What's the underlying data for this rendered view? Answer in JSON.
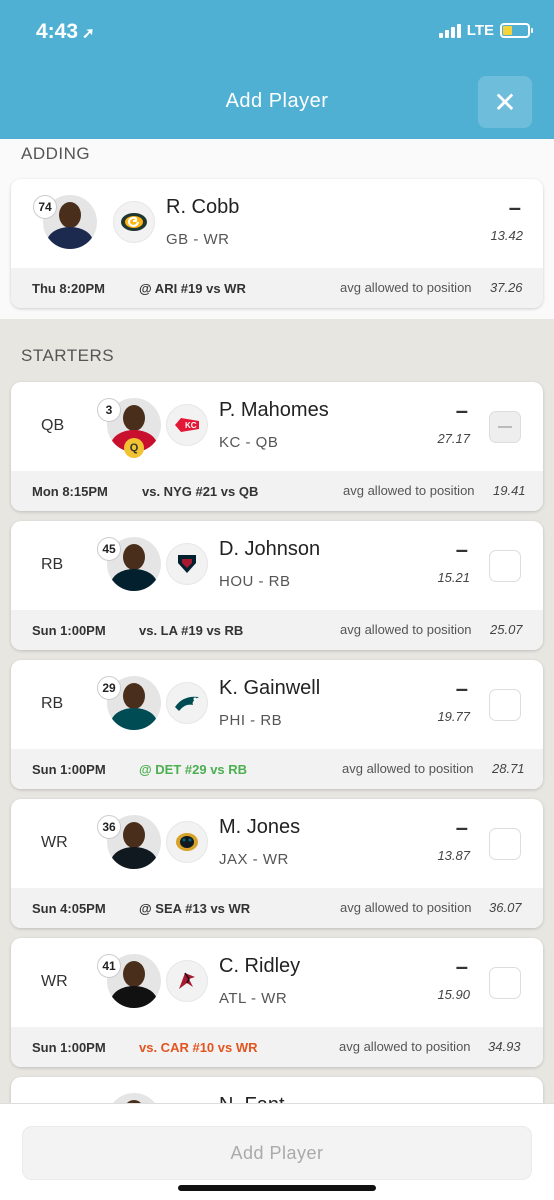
{
  "status_bar": {
    "time": "4:43",
    "network": "LTE"
  },
  "header": {
    "title": "Add Player",
    "close_icon": "close-icon"
  },
  "adding": {
    "label": "ADDING",
    "player": {
      "name": "R. Cobb",
      "team_pos": "GB - WR",
      "rank": "74",
      "score": "–",
      "projection": "13.42",
      "game_time": "Thu 8:20PM",
      "opponent": "@ ARI #19 vs WR",
      "avg_label": "avg allowed to position",
      "avg_value": "37.26"
    }
  },
  "starters": {
    "label": "STARTERS",
    "rows": [
      {
        "pos": "QB",
        "rank": "3",
        "injury": "Q",
        "name": "P. Mahomes",
        "team_pos": "KC - QB",
        "score": "–",
        "projection": "27.17",
        "game_time": "Mon 8:15PM",
        "opponent": "vs. NYG #21 vs QB",
        "avg_label": "avg allowed to position",
        "avg_value": "19.41"
      },
      {
        "pos": "RB",
        "rank": "45",
        "name": "D. Johnson",
        "team_pos": "HOU - RB",
        "score": "–",
        "projection": "15.21",
        "game_time": "Sun 1:00PM",
        "opponent": "vs. LA #19 vs RB",
        "avg_label": "avg allowed to position",
        "avg_value": "25.07"
      },
      {
        "pos": "RB",
        "rank": "29",
        "name": "K. Gainwell",
        "team_pos": "PHI - RB",
        "score": "–",
        "projection": "19.77",
        "game_time": "Sun 1:00PM",
        "opponent": "@ DET #29 vs RB",
        "avg_label": "avg allowed to position",
        "avg_value": "28.71"
      },
      {
        "pos": "WR",
        "rank": "36",
        "name": "M. Jones",
        "team_pos": "JAX - WR",
        "score": "–",
        "projection": "13.87",
        "game_time": "Sun 4:05PM",
        "opponent": "@ SEA #13 vs WR",
        "avg_label": "avg allowed to position",
        "avg_value": "36.07"
      },
      {
        "pos": "WR",
        "rank": "41",
        "name": "C. Ridley",
        "team_pos": "ATL - WR",
        "score": "–",
        "projection": "15.90",
        "game_time": "Sun 1:00PM",
        "opponent": "vs. CAR #10 vs WR",
        "avg_label": "avg allowed to position",
        "avg_value": "34.93"
      }
    ],
    "partial_name": "N. Fant"
  },
  "footer": {
    "add_button": "Add Player"
  }
}
